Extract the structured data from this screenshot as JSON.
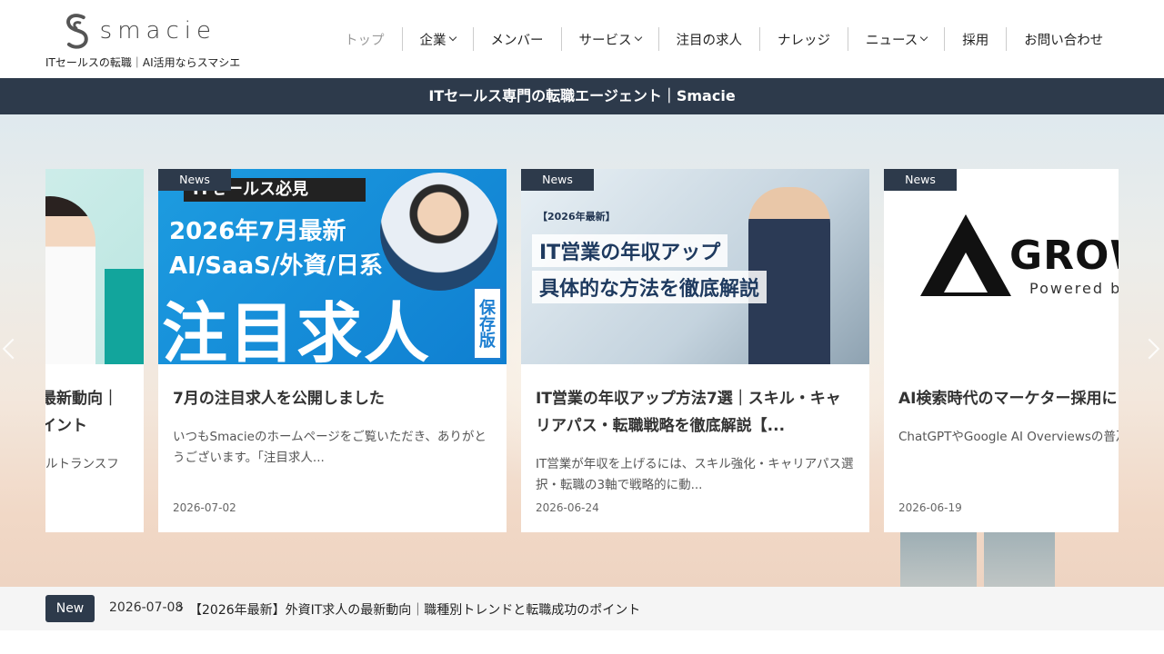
{
  "site": {
    "logo_text": "smacie",
    "tagline": "ITセールスの転職｜AI活用ならスマシエ"
  },
  "nav": [
    {
      "label": "トップ",
      "has_dropdown": false
    },
    {
      "label": "企業",
      "has_dropdown": true
    },
    {
      "label": "メンバー",
      "has_dropdown": false
    },
    {
      "label": "サービス",
      "has_dropdown": true
    },
    {
      "label": "注目の求人",
      "has_dropdown": false
    },
    {
      "label": "ナレッジ",
      "has_dropdown": false
    },
    {
      "label": "ニュース",
      "has_dropdown": true
    },
    {
      "label": "採用",
      "has_dropdown": false
    },
    {
      "label": "お問い合わせ",
      "has_dropdown": false
    }
  ],
  "banner": {
    "text": "ITセールス専門の転職エージェント｜Smacie"
  },
  "carousel": {
    "cards": [
      {
        "category": "",
        "title": "最新動向｜\nイント",
        "excerpt": "ルトランスフ",
        "date": "",
        "image_texts": []
      },
      {
        "category": "News",
        "title": "7月の注目求人を公開しました",
        "excerpt": "いつもSmacieのホームページをご覧いただき、ありがとうございます。「注目求人...",
        "date": "2026-07-02",
        "image_texts": [
          "ITセールス必見",
          "2026年7月最新",
          "AI/SaaS/外資/日系",
          "注目求人",
          "保存版"
        ]
      },
      {
        "category": "News",
        "title": "IT営業の年収アップ方法7選｜スキル・キャリアパス・転職戦略を徹底解説【...",
        "excerpt": "IT営業が年収を上げるには、スキル強化・キャリアパス選択・転職の3軸で戦略的に動...",
        "date": "2026-06-24",
        "image_texts": [
          "【2026年最新】",
          "IT営業の年収アップ",
          "具体的な方法を徹底解説"
        ]
      },
      {
        "category": "News",
        "title": "AI検索時代のマーケター採用に",
        "excerpt": "ChatGPTやGoogle AI Overviewsの普及AISEO・...",
        "date": "2026-06-19",
        "image_texts": [
          "GROW",
          "Powered by"
        ]
      }
    ]
  },
  "ticker": {
    "badge": "New",
    "date": "2026-07-08",
    "text": "【2026年最新】外資IT求人の最新動向｜職種別トレンドと転職成功のポイント"
  },
  "colors": {
    "navy": "#2d3a4b",
    "card_blue": "#1d9ce0",
    "text": "#333333"
  }
}
